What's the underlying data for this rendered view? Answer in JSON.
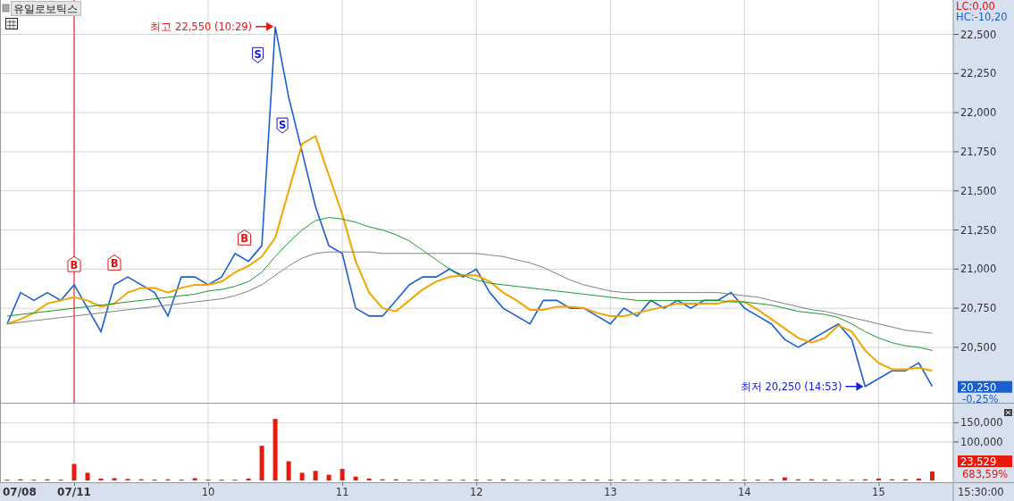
{
  "chart_title": "유일로보틱스",
  "price_panel": {
    "lc_label": "LC:0,00",
    "hc_label": "HC:-10,20",
    "last_price": "20,250",
    "change": "-0,25%",
    "annotation_styles": [
      {
        "kind": "extreme",
        "color": "#f01010"
      },
      {
        "kind": "extreme",
        "color": "#1020e0"
      },
      {
        "kind": "sell"
      },
      {
        "kind": "sell"
      },
      {
        "kind": "buy"
      },
      {
        "kind": "buy"
      },
      {
        "kind": "buy"
      }
    ],
    "chart_data": {
      "type": "line",
      "grid": true,
      "xlim": [
        8.447,
        16.01
      ],
      "ylim": [
        20140,
        22720
      ],
      "x": [
        8.5,
        8.6,
        8.7,
        8.8,
        8.9,
        9,
        9.1,
        9.2,
        9.3,
        9.4,
        9.5,
        9.6,
        9.7,
        9.8,
        9.9,
        10,
        10.1,
        10.2,
        10.3,
        10.4,
        10.5,
        10.6,
        10.7,
        10.8,
        10.9,
        11,
        11.1,
        11.2,
        11.3,
        11.4,
        11.5,
        11.6,
        11.7,
        11.8,
        11.9,
        12,
        12.1,
        12.2,
        12.3,
        12.4,
        12.5,
        12.6,
        12.7,
        12.8,
        12.9,
        13,
        13.1,
        13.2,
        13.3,
        13.4,
        13.5,
        13.6,
        13.7,
        13.8,
        13.9,
        14,
        14.1,
        14.2,
        14.3,
        14.4,
        14.5,
        14.6,
        14.7,
        14.8,
        14.9,
        15,
        15.1,
        15.2,
        15.3,
        15.4
      ],
      "yticks": [
        {
          "value": 20500,
          "label": "20,500"
        },
        {
          "value": 20750,
          "label": "20,750"
        },
        {
          "value": 21000,
          "label": "21,000"
        },
        {
          "value": 21250,
          "label": "21,250"
        },
        {
          "value": 21500,
          "label": "21,500"
        },
        {
          "value": 21750,
          "label": "21,750"
        },
        {
          "value": 22000,
          "label": "22,000"
        },
        {
          "value": 22250,
          "label": "22,250"
        },
        {
          "value": 22500,
          "label": "22,500"
        }
      ],
      "ref_lines": [
        {
          "axis": "x",
          "value": 9,
          "color": "#e01010"
        }
      ],
      "series": [
        {
          "color": "#1a5fd0",
          "values": [
            20650,
            20850,
            20800,
            20850,
            20800,
            20900,
            20750,
            20600,
            20900,
            20950,
            20900,
            20850,
            20700,
            20950,
            20950,
            20900,
            20950,
            21100,
            21050,
            21150,
            22550,
            22100,
            21750,
            21400,
            21150,
            21100,
            20750,
            20700,
            20700,
            20800,
            20900,
            20950,
            20950,
            21000,
            20950,
            21000,
            20850,
            20750,
            20700,
            20650,
            20800,
            20800,
            20750,
            20750,
            20700,
            20650,
            20750,
            20700,
            20800,
            20750,
            20800,
            20750,
            20800,
            20800,
            20850,
            20750,
            20700,
            20650,
            20550,
            20500,
            20550,
            20600,
            20650,
            20550,
            20250,
            20300,
            20350,
            20350,
            20400,
            20250
          ]
        },
        {
          "color": "#f0a500",
          "values": [
            20650,
            20680,
            20720,
            20780,
            20800,
            20820,
            20800,
            20760,
            20780,
            20850,
            20880,
            20880,
            20850,
            20880,
            20900,
            20900,
            20920,
            20980,
            21020,
            21080,
            21200,
            21500,
            21800,
            21850,
            21600,
            21350,
            21050,
            20850,
            20750,
            20730,
            20800,
            20870,
            20920,
            20950,
            20960,
            20960,
            20920,
            20850,
            20800,
            20740,
            20740,
            20760,
            20760,
            20750,
            20720,
            20700,
            20700,
            20720,
            20740,
            20760,
            20780,
            20780,
            20780,
            20780,
            20800,
            20790,
            20740,
            20680,
            20620,
            20560,
            20530,
            20560,
            20640,
            20600,
            20480,
            20400,
            20360,
            20360,
            20370,
            20350
          ]
        },
        {
          "color": "#1a9a30",
          "values": [
            20700,
            20710,
            20720,
            20730,
            20740,
            20750,
            20760,
            20770,
            20780,
            20790,
            20800,
            20810,
            20820,
            20830,
            20840,
            20860,
            20870,
            20890,
            20920,
            20980,
            21080,
            21170,
            21250,
            21310,
            21330,
            21320,
            21300,
            21270,
            21250,
            21220,
            21180,
            21120,
            21060,
            21000,
            20960,
            20930,
            20910,
            20900,
            20890,
            20880,
            20870,
            20860,
            20850,
            20840,
            20830,
            20820,
            20810,
            20800,
            20800,
            20800,
            20800,
            20800,
            20800,
            20800,
            20790,
            20790,
            20780,
            20770,
            20750,
            20730,
            20720,
            20710,
            20690,
            20650,
            20600,
            20560,
            20530,
            20510,
            20500,
            20480
          ]
        },
        {
          "color": "#808080",
          "values": [
            20650,
            20660,
            20670,
            20680,
            20690,
            20700,
            20710,
            20720,
            20730,
            20740,
            20750,
            20760,
            20770,
            20780,
            20790,
            20800,
            20810,
            20830,
            20860,
            20900,
            20960,
            21020,
            21070,
            21100,
            21110,
            21110,
            21110,
            21110,
            21100,
            21100,
            21100,
            21100,
            21100,
            21100,
            21100,
            21100,
            21090,
            21080,
            21060,
            21040,
            21010,
            20970,
            20930,
            20900,
            20880,
            20860,
            20850,
            20850,
            20850,
            20850,
            20850,
            20850,
            20850,
            20850,
            20840,
            20830,
            20820,
            20800,
            20780,
            20760,
            20740,
            20730,
            20710,
            20690,
            20670,
            20650,
            20630,
            20610,
            20600,
            20590
          ]
        }
      ],
      "annotations": [
        {
          "text": "최고 22,550 (10:29)",
          "x": 10.5,
          "y": 22550
        },
        {
          "text": "최저 20,250 (14:53)",
          "x": 14.9,
          "y": 20250
        },
        {
          "text": "S",
          "x": 10.37,
          "y": 22370
        },
        {
          "text": "S",
          "x": 10.553,
          "y": 21920
        },
        {
          "text": "B",
          "x": 9,
          "y": 21030
        },
        {
          "text": "B",
          "x": 9.3,
          "y": 21040
        },
        {
          "text": "B",
          "x": 10.27,
          "y": 21200
        }
      ]
    }
  },
  "volume_panel": {
    "last_volume": "23,529",
    "ratio": "683,59%",
    "start_date_label": "07/08",
    "chart_data": {
      "type": "bar",
      "grid": true,
      "xlim": [
        8.447,
        16.01
      ],
      "ylim": [
        0,
        195000
      ],
      "x": [
        8.5,
        8.6,
        8.7,
        8.8,
        8.9,
        9,
        9.1,
        9.2,
        9.3,
        9.4,
        9.5,
        9.6,
        9.7,
        9.8,
        9.9,
        10,
        10.1,
        10.2,
        10.3,
        10.4,
        10.5,
        10.6,
        10.7,
        10.8,
        10.9,
        11,
        11.1,
        11.2,
        11.3,
        11.4,
        11.5,
        11.6,
        11.7,
        11.8,
        11.9,
        12,
        12.1,
        12.2,
        12.3,
        12.4,
        12.5,
        12.6,
        12.7,
        12.8,
        12.9,
        13,
        13.1,
        13.2,
        13.3,
        13.4,
        13.5,
        13.6,
        13.7,
        13.8,
        13.9,
        14,
        14.1,
        14.2,
        14.3,
        14.4,
        14.5,
        14.6,
        14.7,
        14.8,
        14.9,
        15,
        15.1,
        15.2,
        15.3,
        15.4
      ],
      "xticks": [
        {
          "value": 9,
          "label": "07/11"
        },
        10,
        11,
        12,
        13,
        14,
        15
      ],
      "yticks": [
        {
          "value": 100000,
          "label": "100,000"
        },
        {
          "value": 150000,
          "label": "150,000"
        }
      ],
      "series": [
        {
          "color": "#e81a0c",
          "values": [
            2000,
            3000,
            2000,
            3000,
            2000,
            43000,
            20000,
            5000,
            6000,
            4000,
            3000,
            2000,
            3000,
            2000,
            6000,
            2000,
            2000,
            2000,
            5000,
            90000,
            160000,
            50000,
            20000,
            25000,
            15000,
            30000,
            10000,
            5000,
            3000,
            3000,
            2000,
            2000,
            2000,
            2000,
            2000,
            2000,
            2000,
            3000,
            2000,
            2000,
            2000,
            2000,
            2000,
            2000,
            2000,
            2000,
            2000,
            2000,
            2000,
            2000,
            2000,
            2000,
            2000,
            2000,
            2000,
            2000,
            2000,
            3000,
            8000,
            3000,
            3000,
            2000,
            2000,
            2000,
            3000,
            5000,
            3000,
            3000,
            5000,
            23529
          ]
        }
      ]
    }
  },
  "time_label": "15:30:00"
}
